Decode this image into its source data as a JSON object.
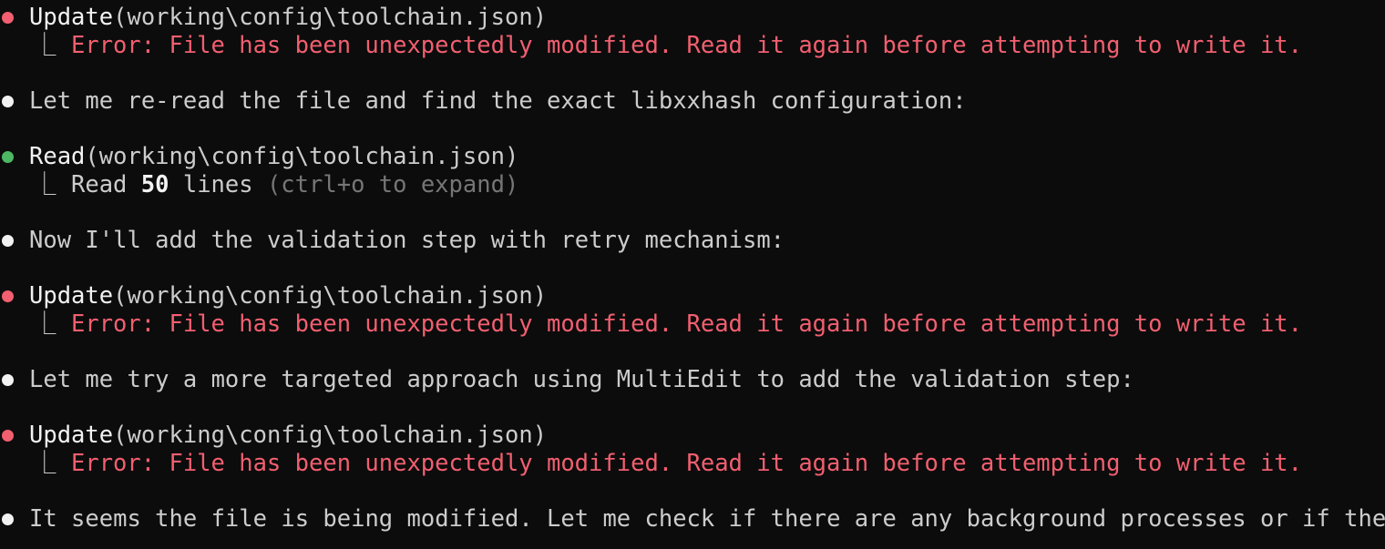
{
  "colors": {
    "background": "#0c0c0c",
    "error": "#f25f70",
    "success": "#4db863",
    "text": "#cccccc",
    "dim": "#767676"
  },
  "branch_glyph": "⎿",
  "entries": [
    {
      "kind": "tool",
      "status": "error",
      "tool": "Update",
      "arg": "(working\\config\\toolchain.json)",
      "result": "Error: File has been unexpectedly modified. Read it again before attempting to write it."
    },
    {
      "kind": "message",
      "text": "Let me re-read the file and find the exact libxxhash configuration:"
    },
    {
      "kind": "tool",
      "status": "success",
      "tool": "Read",
      "arg": "(working\\config\\toolchain.json)",
      "result_prefix": "Read ",
      "result_count": "50",
      "result_suffix": " lines ",
      "result_hint": "(ctrl+o to expand)"
    },
    {
      "kind": "message",
      "text": "Now I'll add the validation step with retry mechanism:"
    },
    {
      "kind": "tool",
      "status": "error",
      "tool": "Update",
      "arg": "(working\\config\\toolchain.json)",
      "result": "Error: File has been unexpectedly modified. Read it again before attempting to write it."
    },
    {
      "kind": "message",
      "text": "Let me try a more targeted approach using MultiEdit to add the validation step:"
    },
    {
      "kind": "tool",
      "status": "error",
      "tool": "Update",
      "arg": "(working\\config\\toolchain.json)",
      "result": "Error: File has been unexpectedly modified. Read it again before attempting to write it."
    },
    {
      "kind": "message",
      "text": "It seems the file is being modified. Let me check if there are any background processes or if the"
    }
  ]
}
